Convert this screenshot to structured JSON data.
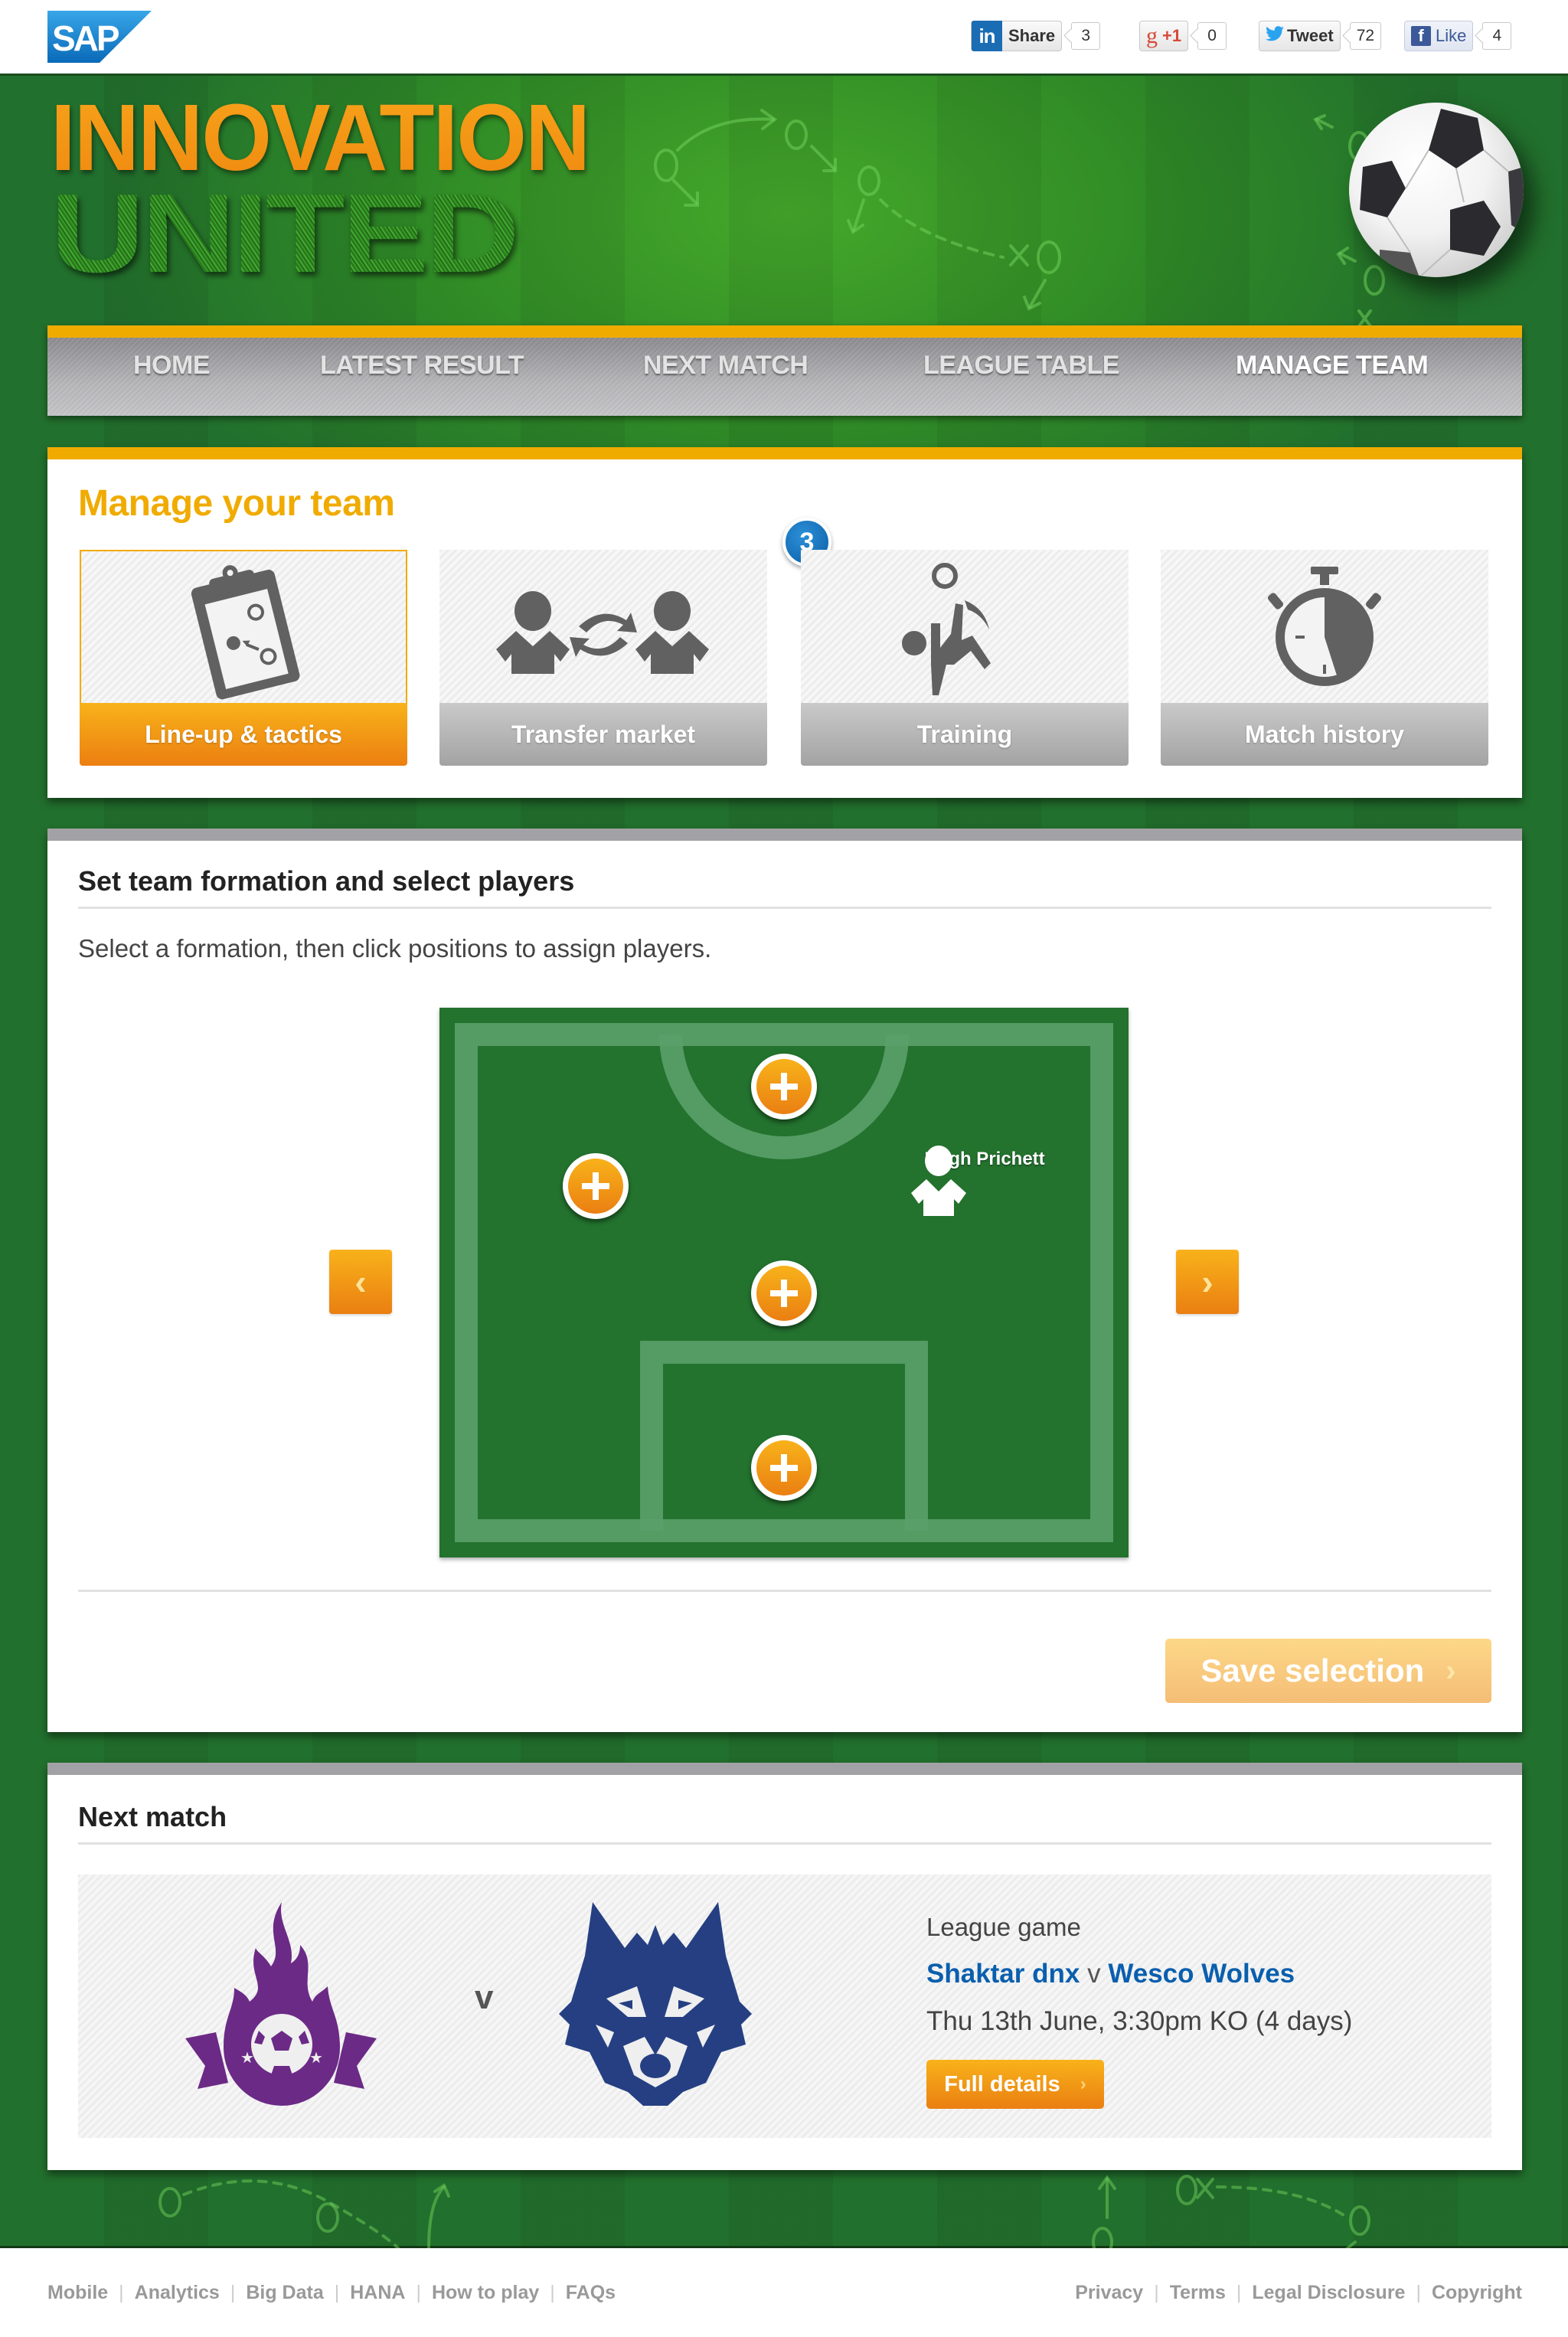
{
  "brand": {
    "logo_text": "SAP",
    "colors": {
      "accent": "#f0ab00",
      "orange": "#ea7f12",
      "green": "#23722e",
      "link": "#0a5fae",
      "badge": "#0c5fa5"
    }
  },
  "social": [
    {
      "name": "linkedin",
      "icon": "in",
      "label": "Share",
      "count": "3"
    },
    {
      "name": "googleplus",
      "icon": "g",
      "label": "+1",
      "count": "0"
    },
    {
      "name": "twitter",
      "icon": "twitter-bird-icon",
      "label": "Tweet",
      "count": "72"
    },
    {
      "name": "facebook",
      "icon": "f",
      "label": "Like",
      "count": "4"
    }
  ],
  "header": {
    "title_line1": "INNOVATION",
    "title_line2": "UNITED"
  },
  "nav": {
    "items": [
      {
        "label": "HOME",
        "active": false
      },
      {
        "label": "LATEST RESULT",
        "active": false
      },
      {
        "label": "NEXT MATCH",
        "active": false
      },
      {
        "label": "LEAGUE TABLE",
        "active": false
      },
      {
        "label": "MANAGE TEAM",
        "active": true
      }
    ]
  },
  "manage": {
    "title": "Manage your team",
    "tiles": [
      {
        "label": "Line-up & tactics",
        "icon": "clipboard-tactics-icon",
        "active": true
      },
      {
        "label": "Transfer market",
        "icon": "player-swap-icon",
        "active": false,
        "badge": "3"
      },
      {
        "label": "Training",
        "icon": "bicycle-kick-icon",
        "active": false
      },
      {
        "label": "Match history",
        "icon": "stopwatch-icon",
        "active": false
      }
    ]
  },
  "formation": {
    "title": "Set team formation and select players",
    "hint": "Select a formation, then click positions to assign players.",
    "prev_label": "‹",
    "next_label": "›",
    "positions": [
      {
        "slot": "top-center",
        "assigned": false
      },
      {
        "slot": "left",
        "assigned": false
      },
      {
        "slot": "right",
        "assigned": true,
        "player": "Hugh Prichett"
      },
      {
        "slot": "center",
        "assigned": false
      },
      {
        "slot": "goal",
        "assigned": false
      }
    ],
    "save_label": "Save selection",
    "save_chevron": "›"
  },
  "next_match": {
    "title": "Next match",
    "home_crest": "flame-ball-crest-icon",
    "away_crest": "wolf-crest-icon",
    "vs": "v",
    "type": "League game",
    "home_team": "Shaktar dnx",
    "separator": "v",
    "away_team": "Wesco Wolves",
    "date": "Thu 13th June, 3:30pm KO (4 days)",
    "details_label": "Full details",
    "details_chevron": "›"
  },
  "footer": {
    "left_links": [
      "Mobile",
      "Analytics",
      "Big Data",
      "HANA",
      "How to play",
      "FAQs"
    ],
    "right_links": [
      "Privacy",
      "Terms",
      "Legal Disclosure",
      "Copyright"
    ],
    "separator": "|"
  }
}
